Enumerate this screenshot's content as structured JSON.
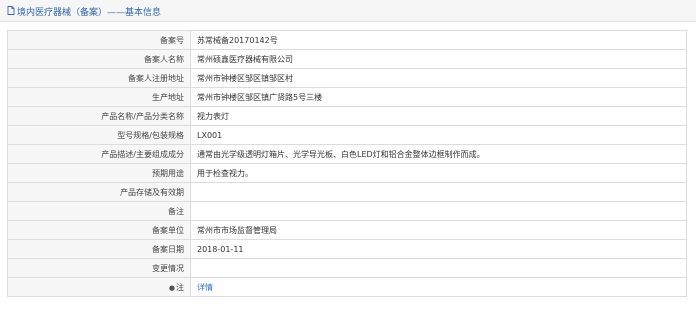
{
  "header": {
    "title": "境内医疗器械（备案）——基本信息"
  },
  "rows": [
    {
      "label": "备案号",
      "value": "苏常械备20170142号"
    },
    {
      "label": "备案人名称",
      "value": "常州硕鑫医疗器械有限公司"
    },
    {
      "label": "备案人注册地址",
      "value": "常州市钟楼区邹区镇邹区村"
    },
    {
      "label": "生产地址",
      "value": "常州市钟楼区邹区镇广贤路5号三楼"
    },
    {
      "label": "产品名称/产品分类名称",
      "value": "视力表灯"
    },
    {
      "label": "型号规格/包装规格",
      "value": "LX001"
    },
    {
      "label": "产品描述/主要组成成分",
      "value": "通常由光学级透明灯箱片、光学导光板、白色LED灯和铝合金整体边框制作而成。"
    },
    {
      "label": "预期用途",
      "value": "用于检查视力。"
    },
    {
      "label": "产品存储及有效期",
      "value": ""
    },
    {
      "label": "备注",
      "value": ""
    },
    {
      "label": "备案单位",
      "value": "常州市市场监督管理局"
    },
    {
      "label": "备案日期",
      "value": "2018-01-11"
    },
    {
      "label": "变更情况",
      "value": ""
    }
  ],
  "note_row": {
    "label": "注",
    "link": "详情"
  }
}
